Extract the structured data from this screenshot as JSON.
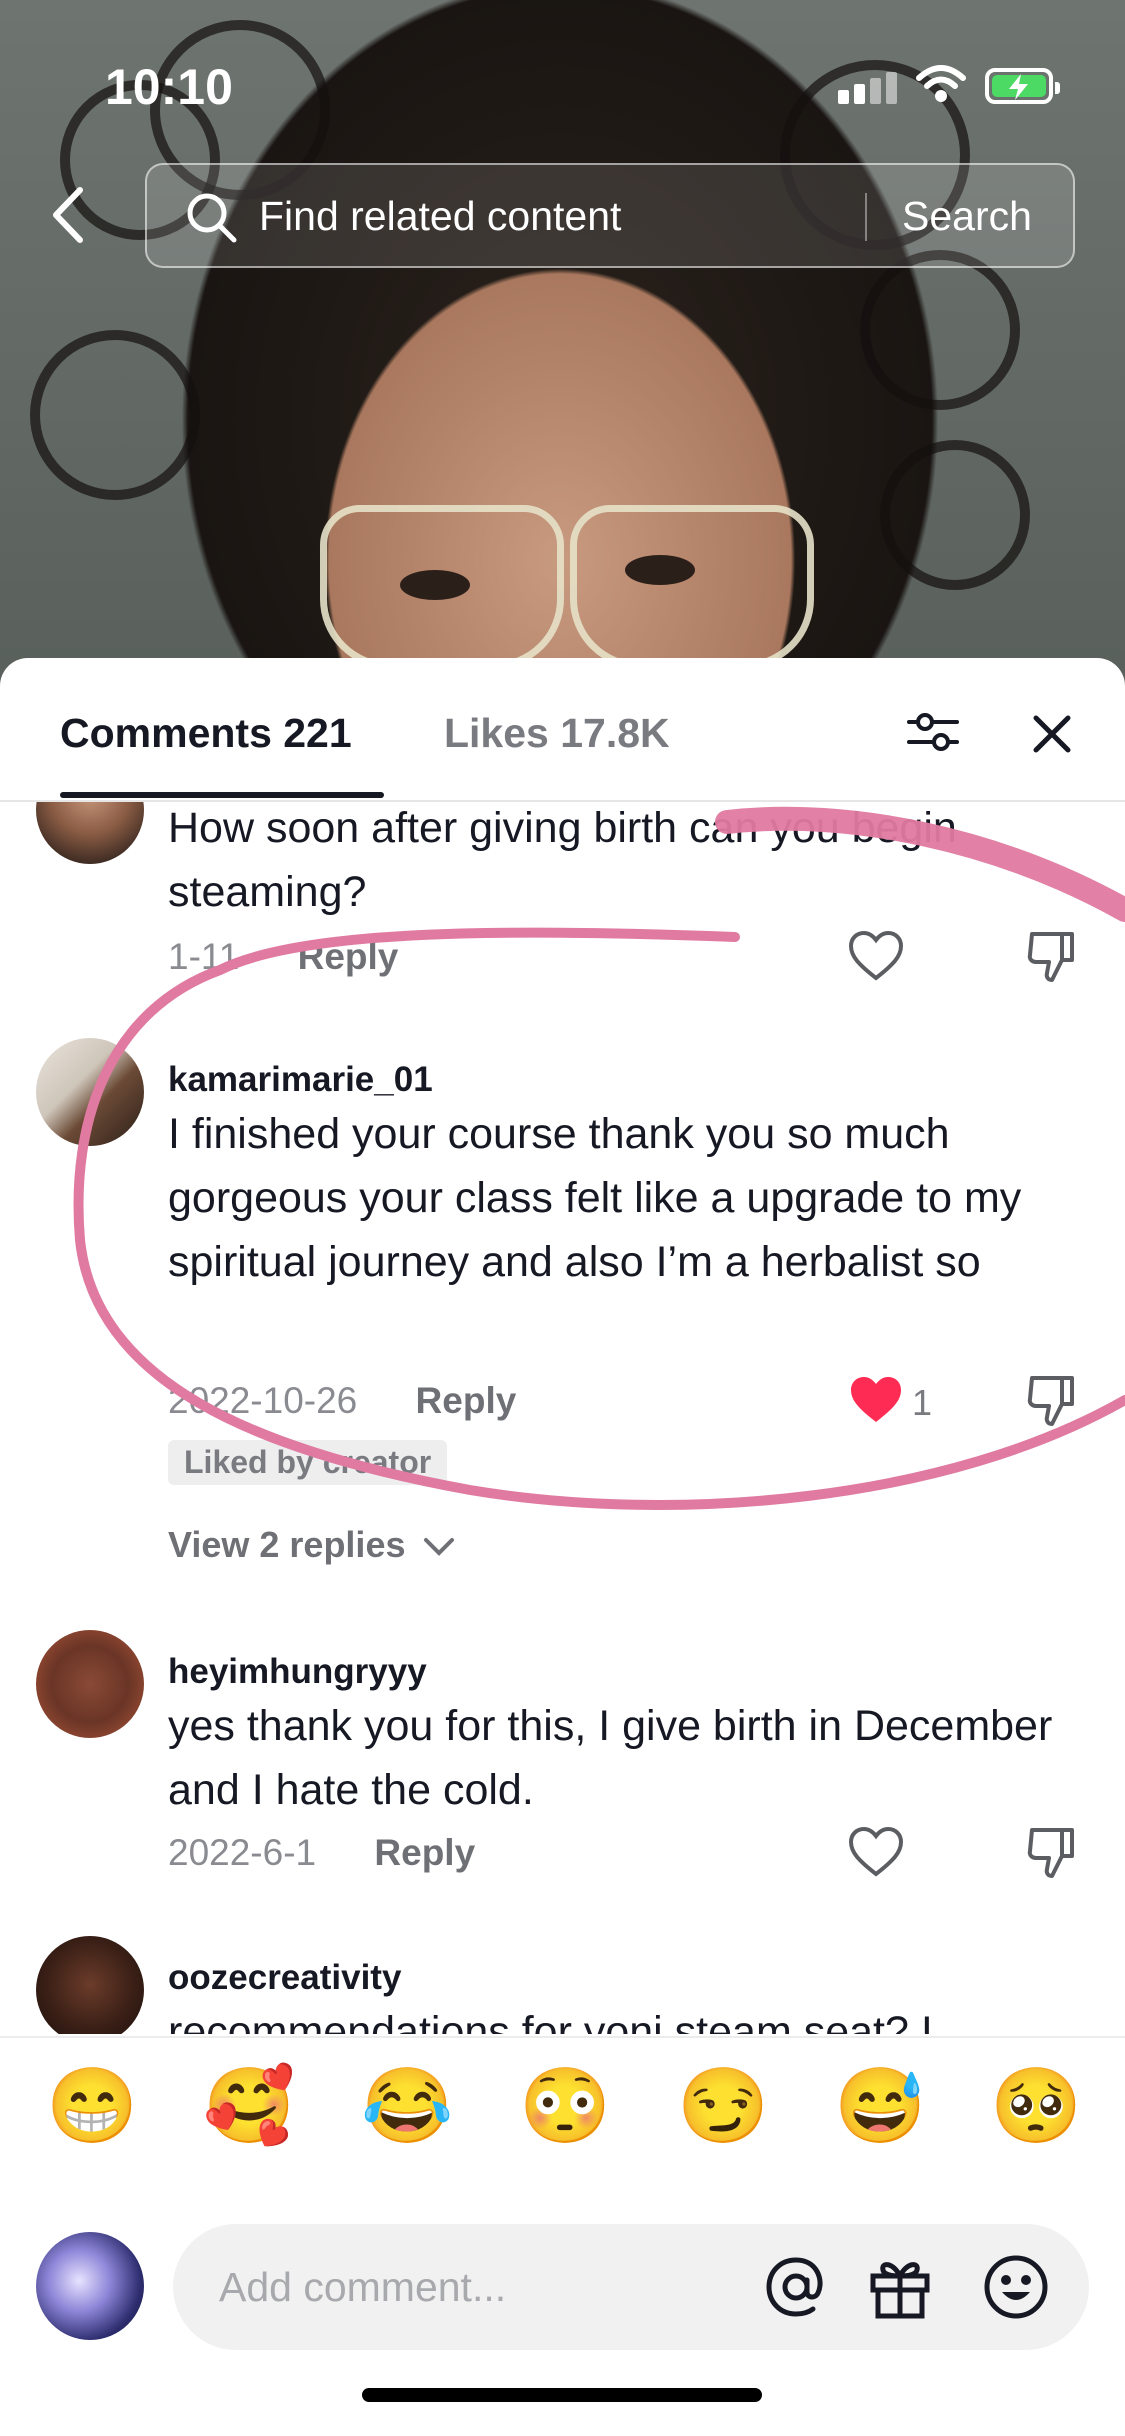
{
  "status_bar": {
    "time": "10:10"
  },
  "search": {
    "placeholder": "Find related content",
    "button": "Search"
  },
  "tabs": {
    "comments": "Comments 221",
    "likes": "Likes 17.8K"
  },
  "comments": [
    {
      "username": "",
      "text": "How soon after giving birth can you begin steaming?",
      "date": "1-11",
      "reply": "Reply",
      "liked": false
    },
    {
      "username": "kamarimarie_01",
      "text": "I finished your course thank you so much gorgeous your class felt like a upgrade to my spiritual journey and also I’m a herbalist so",
      "date": "2022-10-26",
      "reply": "Reply",
      "liked": true,
      "like_count": "1",
      "badge": "Liked by creator",
      "view_replies": "View 2 replies"
    },
    {
      "username": "heyimhungryyy",
      "text": "yes thank you for this, I give birth in December and I hate the cold.",
      "date": "2022-6-1",
      "reply": "Reply",
      "liked": false
    },
    {
      "username": "oozecreativity",
      "text": "recommendations for yoni steam seat? I",
      "liked": false
    }
  ],
  "emojis": [
    "😁",
    "🥰",
    "😂",
    "😳",
    "😏",
    "😅",
    "🥺"
  ],
  "input": {
    "placeholder": "Add comment..."
  },
  "colors": {
    "like_red": "#fe2c55",
    "annotation_pink": "#e07aa0",
    "text": "#161823",
    "muted": "#8a8b91"
  }
}
